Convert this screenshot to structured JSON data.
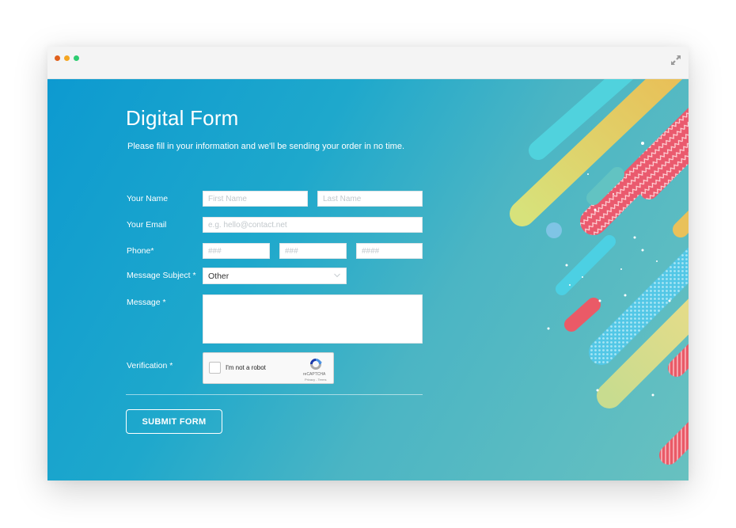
{
  "window": {
    "controls": [
      "close-dot",
      "minimize-dot",
      "maximize-dot"
    ],
    "expand_icon": "expand-arrows-icon"
  },
  "form": {
    "title": "Digital Form",
    "subtitle": "Please fill in your information and we'll be sending your order in no time.",
    "name": {
      "label": "Your Name",
      "first_placeholder": "First Name",
      "last_placeholder": "Last Name",
      "first_value": "",
      "last_value": ""
    },
    "email": {
      "label": "Your Email",
      "placeholder": "e.g. hello@contact.net",
      "value": ""
    },
    "phone": {
      "label": "Phone*",
      "area_placeholder": "###",
      "prefix_placeholder": "###",
      "line_placeholder": "####"
    },
    "subject": {
      "label": "Message Subject *",
      "selected": "Other"
    },
    "message": {
      "label": "Message *",
      "value": ""
    },
    "verification": {
      "label": "Verification *",
      "checkbox_text": "I'm not a robot",
      "brand": "reCAPTCHA",
      "links": "Privacy - Terms",
      "checked": false
    },
    "submit_label": "SUBMIT FORM"
  },
  "colors": {
    "gradient_start": "#0d9ad0",
    "gradient_end": "#68c1c0",
    "accent_red": "#ea5a67",
    "accent_yellow": "#e8c65a",
    "accent_cyan": "#4fd3df",
    "accent_lime": "#d6e27c"
  }
}
